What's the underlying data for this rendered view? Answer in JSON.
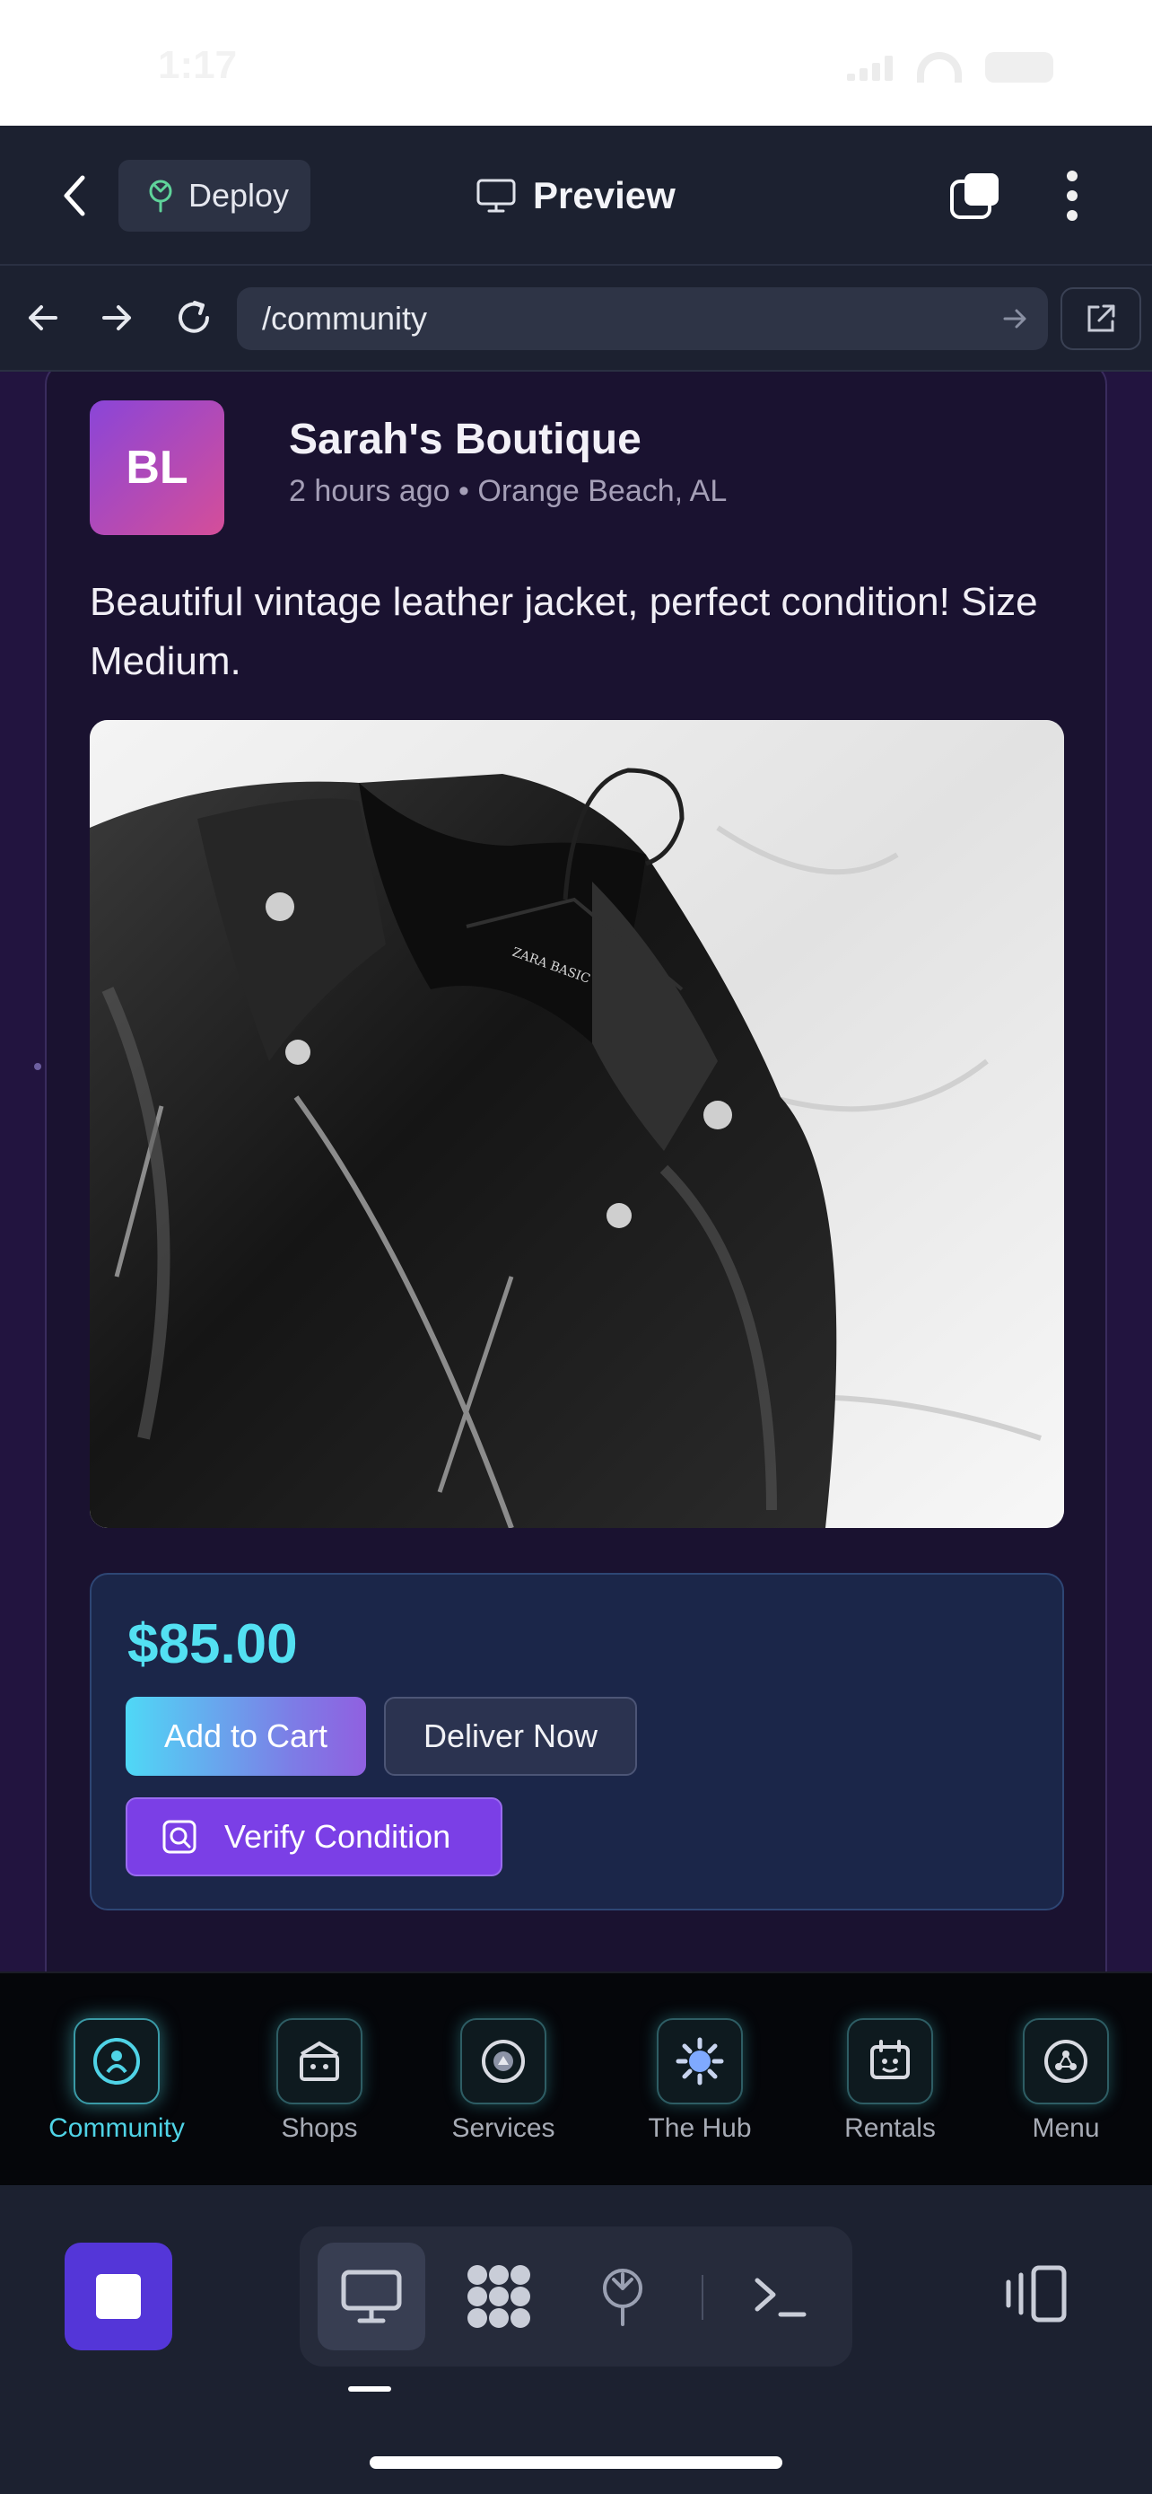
{
  "status_bar": {
    "time": "1:17"
  },
  "header": {
    "deploy_label": "Deploy",
    "title": "Preview"
  },
  "url_bar": {
    "value": "/community"
  },
  "post": {
    "avatar_initials": "BL",
    "shop_name": "Sarah's Boutique",
    "time_ago": "2 hours ago",
    "separator": "•",
    "location": "Orange Beach, AL",
    "text": "Beautiful vintage leather jacket, perfect condition! Size Medium.",
    "image_label": "ZARA BASIC",
    "price": "$85.00",
    "add_to_cart_label": "Add to Cart",
    "deliver_label": "Deliver Now",
    "verify_label": "Verify Condition"
  },
  "tabs": [
    {
      "label": "Community",
      "icon": "community-icon",
      "active": true
    },
    {
      "label": "Shops",
      "icon": "shop-icon"
    },
    {
      "label": "Services",
      "icon": "services-icon"
    },
    {
      "label": "The Hub",
      "icon": "hub-icon"
    },
    {
      "label": "Rentals",
      "icon": "rentals-icon"
    },
    {
      "label": "Menu",
      "icon": "menu-icon"
    }
  ],
  "colors": {
    "accent_cyan": "#53e0f2",
    "accent_purple": "#7b3fe6",
    "workspace_purple": "#5436d8"
  }
}
